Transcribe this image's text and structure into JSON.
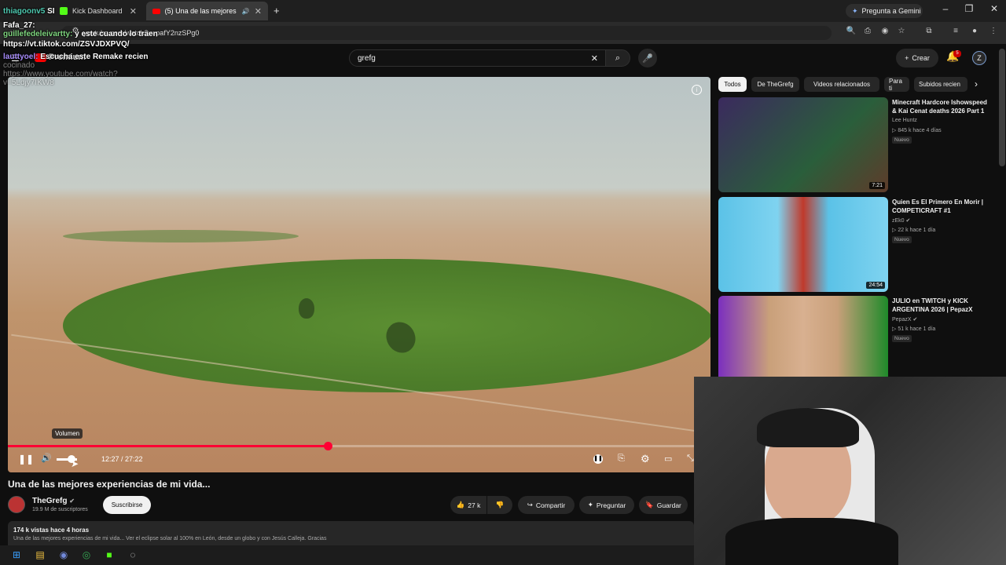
{
  "browser": {
    "tabs": [
      {
        "label": "Kick Dashboard"
      },
      {
        "label": "(5) Una de las mejores expe"
      }
    ],
    "gemini": "Pregunta a Gemini",
    "url": "youtube.com/watch?v=pafY2nzSPg0"
  },
  "youtube": {
    "logo": "Premium",
    "search_value": "grefg",
    "create_label": "Crear",
    "notif_count": "5",
    "avatar_letter": "Z"
  },
  "chat": [
    {
      "user": "thiagoonv5",
      "text": "SI"
    },
    {
      "user": "Fafa_27:",
      "text": ""
    },
    {
      "user": "guillefedeleivartty:",
      "text": "y este cuando lo traen"
    },
    {
      "user": "",
      "text": "https://vt.tiktok.com/ZSVJDXPVQ/"
    },
    {
      "user": "lauttyoel:",
      "text": "Escucha este Remake recien"
    },
    {
      "user": "",
      "text": "cocinado"
    },
    {
      "user": "",
      "text": "https://www.youtube.com/watch?"
    },
    {
      "user": "",
      "text": "v=5Ldjy7IKW8"
    }
  ],
  "player": {
    "tooltip": "Volumen",
    "time": "12:27 / 27:22",
    "progress_fraction": 0.455
  },
  "video": {
    "title": "Una de las mejores experiencias de mi vida...",
    "channel": "TheGrefg",
    "subscribers": "19.9 M de suscriptores",
    "subscribe_label": "Suscribirse",
    "likes": "27 k",
    "share_label": "Compartir",
    "ask_label": "Preguntar",
    "save_label": "Guardar",
    "views": "174 k vistas  hace 4 horas",
    "desc_preview": "Una de las mejores experiencias de mi vida... Ver el eclipse solar al 100% en León, desde un globo y con Jesús Calleja. Gracias"
  },
  "chips": [
    "Todos",
    "De TheGrefg",
    "Videos relacionados",
    "Para ti",
    "Subidos recien"
  ],
  "related": [
    {
      "title": "Minecraft Hardcore Ishowspeed & Kai Cenat deaths 2026 Part 1",
      "channel": "Lee Huntz",
      "meta": "845 k  hace 4 días",
      "badge": "Nuevo",
      "duration": "7:21"
    },
    {
      "title": "Quien Es El Primero En Morir | COMPETICRAFT #1",
      "channel": "zEk0",
      "meta": "22 k  hace 1 día",
      "badge": "Nuevo",
      "duration": "24:54"
    },
    {
      "title": "JULIO en TWITCH y KICK ARGENTINA 2026 | PepazX",
      "channel": "PepazX",
      "meta": "51 k  hace 1 día",
      "badge": "Nuevo",
      "duration": ""
    }
  ],
  "colors": {
    "accent": "#ff0033",
    "bg": "#0f0f0f"
  }
}
